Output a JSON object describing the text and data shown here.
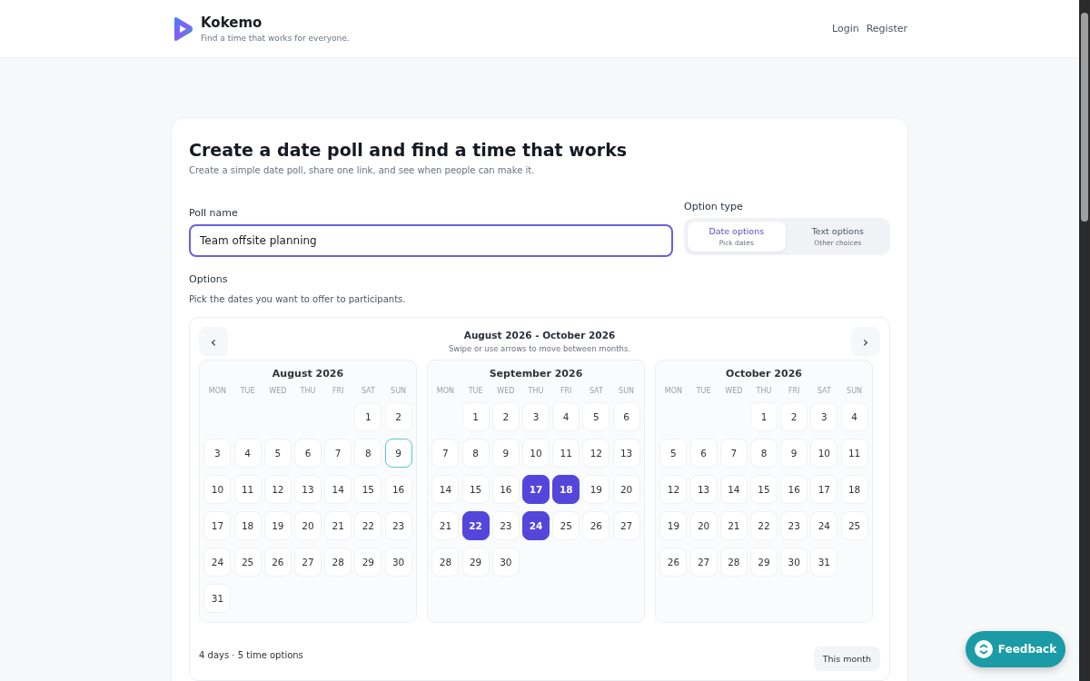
{
  "header": {
    "brand": "Kokemo",
    "tagline": "Find a time that works for everyone.",
    "nav": [
      {
        "label": "Login"
      },
      {
        "label": "Register"
      }
    ]
  },
  "form": {
    "title": "Create a date poll and find a time that works",
    "subtitle": "Create a simple date poll, share one link, and see when people can make it.",
    "poll_name": {
      "label": "Poll name",
      "value": "Team offsite planning"
    },
    "option_type": {
      "label": "Option type",
      "options": [
        {
          "title": "Date options",
          "hint": "Pick dates",
          "selected": true
        },
        {
          "title": "Text options",
          "hint": "Other choices",
          "selected": false
        }
      ]
    },
    "options": {
      "label": "Options",
      "hint": "Pick the dates you want to offer to participants."
    },
    "calendar": {
      "range": "August 2026 - October 2026",
      "hint": "Swipe or use arrows to move between months.",
      "prev": "‹",
      "next": "›",
      "months": [
        {
          "title": "August 2026",
          "weekdays": [
            "MON",
            "TUE",
            "WED",
            "THU",
            "FRI",
            "SAT",
            "SUN"
          ],
          "days": [
            {
              "kind": "blank"
            },
            {
              "kind": "blank"
            },
            {
              "kind": "blank"
            },
            {
              "kind": "blank"
            },
            {
              "kind": "blank"
            },
            {
              "kind": "day",
              "d": "1",
              "selected": false,
              "today": false
            },
            {
              "kind": "day",
              "d": "2",
              "selected": false,
              "today": false
            },
            {
              "kind": "day",
              "d": "3",
              "selected": false,
              "today": false
            },
            {
              "kind": "day",
              "d": "4",
              "selected": false,
              "today": false
            },
            {
              "kind": "day",
              "d": "5",
              "selected": false,
              "today": false
            },
            {
              "kind": "day",
              "d": "6",
              "selected": false,
              "today": false
            },
            {
              "kind": "day",
              "d": "7",
              "selected": false,
              "today": false
            },
            {
              "kind": "day",
              "d": "8",
              "selected": false,
              "today": false
            },
            {
              "kind": "day",
              "d": "9",
              "selected": false,
              "today": true
            },
            {
              "kind": "day",
              "d": "10",
              "selected": false,
              "today": false
            },
            {
              "kind": "day",
              "d": "11",
              "selected": false,
              "today": false
            },
            {
              "kind": "day",
              "d": "12",
              "selected": false,
              "today": false
            },
            {
              "kind": "day",
              "d": "13",
              "selected": false,
              "today": false
            },
            {
              "kind": "day",
              "d": "14",
              "selected": false,
              "today": false
            },
            {
              "kind": "day",
              "d": "15",
              "selected": false,
              "today": false
            },
            {
              "kind": "day",
              "d": "16",
              "selected": false,
              "today": false
            },
            {
              "kind": "day",
              "d": "17",
              "selected": false,
              "today": false
            },
            {
              "kind": "day",
              "d": "18",
              "selected": false,
              "today": false
            },
            {
              "kind": "day",
              "d": "19",
              "selected": false,
              "today": false
            },
            {
              "kind": "day",
              "d": "20",
              "selected": false,
              "today": false
            },
            {
              "kind": "day",
              "d": "21",
              "selected": false,
              "today": false
            },
            {
              "kind": "day",
              "d": "22",
              "selected": false,
              "today": false
            },
            {
              "kind": "day",
              "d": "23",
              "selected": false,
              "today": false
            },
            {
              "kind": "day",
              "d": "24",
              "selected": false,
              "today": false
            },
            {
              "kind": "day",
              "d": "25",
              "selected": false,
              "today": false
            },
            {
              "kind": "day",
              "d": "26",
              "selected": false,
              "today": false
            },
            {
              "kind": "day",
              "d": "27",
              "selected": false,
              "today": false
            },
            {
              "kind": "day",
              "d": "28",
              "selected": false,
              "today": false
            },
            {
              "kind": "day",
              "d": "29",
              "selected": false,
              "today": false
            },
            {
              "kind": "day",
              "d": "30",
              "selected": false,
              "today": false
            },
            {
              "kind": "day",
              "d": "31",
              "selected": false,
              "today": false
            }
          ]
        },
        {
          "title": "September 2026",
          "weekdays": [
            "MON",
            "TUE",
            "WED",
            "THU",
            "FRI",
            "SAT",
            "SUN"
          ],
          "days": [
            {
              "kind": "blank"
            },
            {
              "kind": "day",
              "d": "1",
              "selected": false,
              "today": false
            },
            {
              "kind": "day",
              "d": "2",
              "selected": false,
              "today": false
            },
            {
              "kind": "day",
              "d": "3",
              "selected": false,
              "today": false
            },
            {
              "kind": "day",
              "d": "4",
              "selected": false,
              "today": false
            },
            {
              "kind": "day",
              "d": "5",
              "selected": false,
              "today": false
            },
            {
              "kind": "day",
              "d": "6",
              "selected": false,
              "today": false
            },
            {
              "kind": "day",
              "d": "7",
              "selected": false,
              "today": false
            },
            {
              "kind": "day",
              "d": "8",
              "selected": false,
              "today": false
            },
            {
              "kind": "day",
              "d": "9",
              "selected": false,
              "today": false
            },
            {
              "kind": "day",
              "d": "10",
              "selected": false,
              "today": false
            },
            {
              "kind": "day",
              "d": "11",
              "selected": false,
              "today": false
            },
            {
              "kind": "day",
              "d": "12",
              "selected": false,
              "today": false
            },
            {
              "kind": "day",
              "d": "13",
              "selected": false,
              "today": false
            },
            {
              "kind": "day",
              "d": "14",
              "selected": false,
              "today": false
            },
            {
              "kind": "day",
              "d": "15",
              "selected": false,
              "today": false
            },
            {
              "kind": "day",
              "d": "16",
              "selected": false,
              "today": false
            },
            {
              "kind": "day",
              "d": "17",
              "selected": true,
              "today": false
            },
            {
              "kind": "day",
              "d": "18",
              "selected": true,
              "today": false
            },
            {
              "kind": "day",
              "d": "19",
              "selected": false,
              "today": false
            },
            {
              "kind": "day",
              "d": "20",
              "selected": false,
              "today": false
            },
            {
              "kind": "day",
              "d": "21",
              "selected": false,
              "today": false
            },
            {
              "kind": "day",
              "d": "22",
              "selected": true,
              "today": false
            },
            {
              "kind": "day",
              "d": "23",
              "selected": false,
              "today": false
            },
            {
              "kind": "day",
              "d": "24",
              "selected": true,
              "today": false
            },
            {
              "kind": "day",
              "d": "25",
              "selected": false,
              "today": false
            },
            {
              "kind": "day",
              "d": "26",
              "selected": false,
              "today": false
            },
            {
              "kind": "day",
              "d": "27",
              "selected": false,
              "today": false
            },
            {
              "kind": "day",
              "d": "28",
              "selected": false,
              "today": false
            },
            {
              "kind": "day",
              "d": "29",
              "selected": false,
              "today": false
            },
            {
              "kind": "day",
              "d": "30",
              "selected": false,
              "today": false
            }
          ]
        },
        {
          "title": "October 2026",
          "weekdays": [
            "MON",
            "TUE",
            "WED",
            "THU",
            "FRI",
            "SAT",
            "SUN"
          ],
          "days": [
            {
              "kind": "blank"
            },
            {
              "kind": "blank"
            },
            {
              "kind": "blank"
            },
            {
              "kind": "day",
              "d": "1",
              "selected": false,
              "today": false
            },
            {
              "kind": "day",
              "d": "2",
              "selected": false,
              "today": false
            },
            {
              "kind": "day",
              "d": "3",
              "selected": false,
              "today": false
            },
            {
              "kind": "day",
              "d": "4",
              "selected": false,
              "today": false
            },
            {
              "kind": "day",
              "d": "5",
              "selected": false,
              "today": false
            },
            {
              "kind": "day",
              "d": "6",
              "selected": false,
              "today": false
            },
            {
              "kind": "day",
              "d": "7",
              "selected": false,
              "today": false
            },
            {
              "kind": "day",
              "d": "8",
              "selected": false,
              "today": false
            },
            {
              "kind": "day",
              "d": "9",
              "selected": false,
              "today": false
            },
            {
              "kind": "day",
              "d": "10",
              "selected": false,
              "today": false
            },
            {
              "kind": "day",
              "d": "11",
              "selected": false,
              "today": false
            },
            {
              "kind": "day",
              "d": "12",
              "selected": false,
              "today": false
            },
            {
              "kind": "day",
              "d": "13",
              "selected": false,
              "today": false
            },
            {
              "kind": "day",
              "d": "14",
              "selected": false,
              "today": false
            },
            {
              "kind": "day",
              "d": "15",
              "selected": false,
              "today": false
            },
            {
              "kind": "day",
              "d": "16",
              "selected": false,
              "today": false
            },
            {
              "kind": "day",
              "d": "17",
              "selected": false,
              "today": false
            },
            {
              "kind": "day",
              "d": "18",
              "selected": false,
              "today": false
            },
            {
              "kind": "day",
              "d": "19",
              "selected": false,
              "today": false
            },
            {
              "kind": "day",
              "d": "20",
              "selected": false,
              "today": false
            },
            {
              "kind": "day",
              "d": "21",
              "selected": false,
              "today": false
            },
            {
              "kind": "day",
              "d": "22",
              "selected": false,
              "today": false
            },
            {
              "kind": "day",
              "d": "23",
              "selected": false,
              "today": false
            },
            {
              "kind": "day",
              "d": "24",
              "selected": false,
              "today": false
            },
            {
              "kind": "day",
              "d": "25",
              "selected": false,
              "today": false
            },
            {
              "kind": "day",
              "d": "26",
              "selected": false,
              "today": false
            },
            {
              "kind": "day",
              "d": "27",
              "selected": false,
              "today": false
            },
            {
              "kind": "day",
              "d": "28",
              "selected": false,
              "today": false
            },
            {
              "kind": "day",
              "d": "29",
              "selected": false,
              "today": false
            },
            {
              "kind": "day",
              "d": "30",
              "selected": false,
              "today": false
            },
            {
              "kind": "day",
              "d": "31",
              "selected": false,
              "today": false
            }
          ]
        }
      ]
    },
    "summary": "4 days · 5 time options",
    "this_month": "This month"
  },
  "feedback": {
    "label": "Feedback"
  }
}
